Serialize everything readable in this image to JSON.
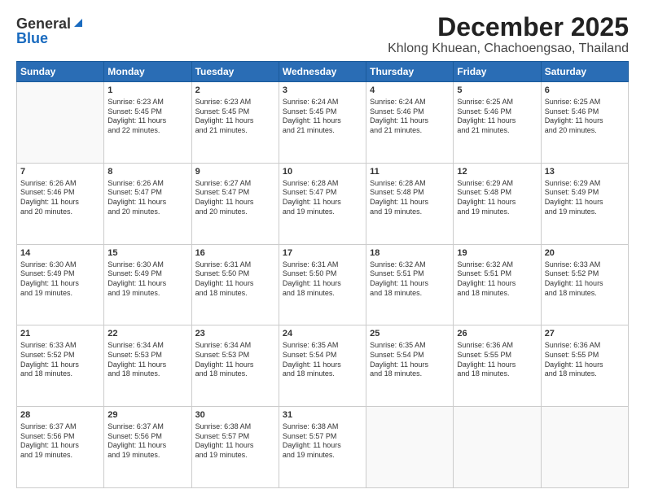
{
  "logo": {
    "general": "General",
    "blue": "Blue"
  },
  "title": "December 2025",
  "subtitle": "Khlong Khuean, Chachoengsao, Thailand",
  "header_days": [
    "Sunday",
    "Monday",
    "Tuesday",
    "Wednesday",
    "Thursday",
    "Friday",
    "Saturday"
  ],
  "weeks": [
    [
      {
        "day": "",
        "info": ""
      },
      {
        "day": "1",
        "info": "Sunrise: 6:23 AM\nSunset: 5:45 PM\nDaylight: 11 hours\nand 22 minutes."
      },
      {
        "day": "2",
        "info": "Sunrise: 6:23 AM\nSunset: 5:45 PM\nDaylight: 11 hours\nand 21 minutes."
      },
      {
        "day": "3",
        "info": "Sunrise: 6:24 AM\nSunset: 5:45 PM\nDaylight: 11 hours\nand 21 minutes."
      },
      {
        "day": "4",
        "info": "Sunrise: 6:24 AM\nSunset: 5:46 PM\nDaylight: 11 hours\nand 21 minutes."
      },
      {
        "day": "5",
        "info": "Sunrise: 6:25 AM\nSunset: 5:46 PM\nDaylight: 11 hours\nand 21 minutes."
      },
      {
        "day": "6",
        "info": "Sunrise: 6:25 AM\nSunset: 5:46 PM\nDaylight: 11 hours\nand 20 minutes."
      }
    ],
    [
      {
        "day": "7",
        "info": "Sunrise: 6:26 AM\nSunset: 5:46 PM\nDaylight: 11 hours\nand 20 minutes."
      },
      {
        "day": "8",
        "info": "Sunrise: 6:26 AM\nSunset: 5:47 PM\nDaylight: 11 hours\nand 20 minutes."
      },
      {
        "day": "9",
        "info": "Sunrise: 6:27 AM\nSunset: 5:47 PM\nDaylight: 11 hours\nand 20 minutes."
      },
      {
        "day": "10",
        "info": "Sunrise: 6:28 AM\nSunset: 5:47 PM\nDaylight: 11 hours\nand 19 minutes."
      },
      {
        "day": "11",
        "info": "Sunrise: 6:28 AM\nSunset: 5:48 PM\nDaylight: 11 hours\nand 19 minutes."
      },
      {
        "day": "12",
        "info": "Sunrise: 6:29 AM\nSunset: 5:48 PM\nDaylight: 11 hours\nand 19 minutes."
      },
      {
        "day": "13",
        "info": "Sunrise: 6:29 AM\nSunset: 5:49 PM\nDaylight: 11 hours\nand 19 minutes."
      }
    ],
    [
      {
        "day": "14",
        "info": "Sunrise: 6:30 AM\nSunset: 5:49 PM\nDaylight: 11 hours\nand 19 minutes."
      },
      {
        "day": "15",
        "info": "Sunrise: 6:30 AM\nSunset: 5:49 PM\nDaylight: 11 hours\nand 19 minutes."
      },
      {
        "day": "16",
        "info": "Sunrise: 6:31 AM\nSunset: 5:50 PM\nDaylight: 11 hours\nand 18 minutes."
      },
      {
        "day": "17",
        "info": "Sunrise: 6:31 AM\nSunset: 5:50 PM\nDaylight: 11 hours\nand 18 minutes."
      },
      {
        "day": "18",
        "info": "Sunrise: 6:32 AM\nSunset: 5:51 PM\nDaylight: 11 hours\nand 18 minutes."
      },
      {
        "day": "19",
        "info": "Sunrise: 6:32 AM\nSunset: 5:51 PM\nDaylight: 11 hours\nand 18 minutes."
      },
      {
        "day": "20",
        "info": "Sunrise: 6:33 AM\nSunset: 5:52 PM\nDaylight: 11 hours\nand 18 minutes."
      }
    ],
    [
      {
        "day": "21",
        "info": "Sunrise: 6:33 AM\nSunset: 5:52 PM\nDaylight: 11 hours\nand 18 minutes."
      },
      {
        "day": "22",
        "info": "Sunrise: 6:34 AM\nSunset: 5:53 PM\nDaylight: 11 hours\nand 18 minutes."
      },
      {
        "day": "23",
        "info": "Sunrise: 6:34 AM\nSunset: 5:53 PM\nDaylight: 11 hours\nand 18 minutes."
      },
      {
        "day": "24",
        "info": "Sunrise: 6:35 AM\nSunset: 5:54 PM\nDaylight: 11 hours\nand 18 minutes."
      },
      {
        "day": "25",
        "info": "Sunrise: 6:35 AM\nSunset: 5:54 PM\nDaylight: 11 hours\nand 18 minutes."
      },
      {
        "day": "26",
        "info": "Sunrise: 6:36 AM\nSunset: 5:55 PM\nDaylight: 11 hours\nand 18 minutes."
      },
      {
        "day": "27",
        "info": "Sunrise: 6:36 AM\nSunset: 5:55 PM\nDaylight: 11 hours\nand 18 minutes."
      }
    ],
    [
      {
        "day": "28",
        "info": "Sunrise: 6:37 AM\nSunset: 5:56 PM\nDaylight: 11 hours\nand 19 minutes."
      },
      {
        "day": "29",
        "info": "Sunrise: 6:37 AM\nSunset: 5:56 PM\nDaylight: 11 hours\nand 19 minutes."
      },
      {
        "day": "30",
        "info": "Sunrise: 6:38 AM\nSunset: 5:57 PM\nDaylight: 11 hours\nand 19 minutes."
      },
      {
        "day": "31",
        "info": "Sunrise: 6:38 AM\nSunset: 5:57 PM\nDaylight: 11 hours\nand 19 minutes."
      },
      {
        "day": "",
        "info": ""
      },
      {
        "day": "",
        "info": ""
      },
      {
        "day": "",
        "info": ""
      }
    ]
  ]
}
